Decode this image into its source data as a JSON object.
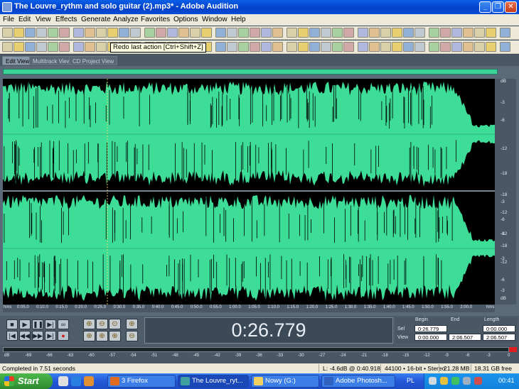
{
  "window": {
    "title": "The Louvre_rythm and solo guitar (2).mp3* - Adobe Audition"
  },
  "menu": [
    "File",
    "Edit",
    "View",
    "Effects",
    "Generate",
    "Analyze",
    "Favorites",
    "Options",
    "Window",
    "Help"
  ],
  "tooltip": "Redo last action  [Ctrl+Shift+Z]",
  "tabs": [
    "Edit View",
    "Multitrack View",
    "CD Project View"
  ],
  "waveform": {
    "color": "#3ddc97",
    "vertical_ruler_label": "dB",
    "channel_scale": [
      "dB",
      "-3",
      "-6",
      "-12",
      "-18",
      "-18",
      "-12",
      "-6",
      "-3"
    ],
    "horizontal_ruler_unit": "hms",
    "time_ticks": [
      "0:05.0",
      "0:10.0",
      "0:15.0",
      "0:20.0",
      "0:25.0",
      "0:30.0",
      "0:35.0",
      "0:40.0",
      "0:45.0",
      "0:50.0",
      "0:55.0",
      "1:00.0",
      "1:05.0",
      "1:10.0",
      "1:15.0",
      "1:20.0",
      "1:25.0",
      "1:30.0",
      "1:35.0",
      "1:40.0",
      "1:45.0",
      "1:50.0",
      "1:55.0",
      "2:00.0"
    ]
  },
  "time_display": "0:26.779",
  "selection_view": {
    "headers": [
      "Begin",
      "End",
      "Length"
    ],
    "sel_label": "Sel",
    "view_label": "View",
    "sel": [
      "0:26.779",
      "",
      "0:00.000"
    ],
    "view": [
      "0:00.000",
      "2:06.507",
      "2:06.507"
    ]
  },
  "level_meter": {
    "ticks": [
      "dB",
      "-69",
      "-66",
      "-63",
      "-60",
      "-57",
      "-54",
      "-51",
      "-48",
      "-45",
      "-42",
      "-39",
      "-36",
      "-33",
      "-30",
      "-27",
      "-24",
      "-21",
      "-18",
      "-15",
      "-12",
      "-9",
      "-6",
      "-3",
      "0"
    ]
  },
  "status": {
    "message": "Completed in 7.51 seconds",
    "level": "L: -4.6dB @ 0:40.918",
    "format": "44100 • 16-bit • Stereo",
    "size": "21.28 MB",
    "free": "18.31 GB free"
  },
  "taskbar": {
    "start": "Start",
    "items": [
      {
        "label": "3 Firefox",
        "icon": "firefox-icon"
      },
      {
        "label": "The Louvre_ryt...",
        "icon": "audition-icon"
      },
      {
        "label": "Nowy (G:)",
        "icon": "folder-icon"
      },
      {
        "label": "Adobe Photosh...",
        "icon": "photoshop-icon"
      }
    ],
    "lang": "PL",
    "clock": "00:41"
  }
}
